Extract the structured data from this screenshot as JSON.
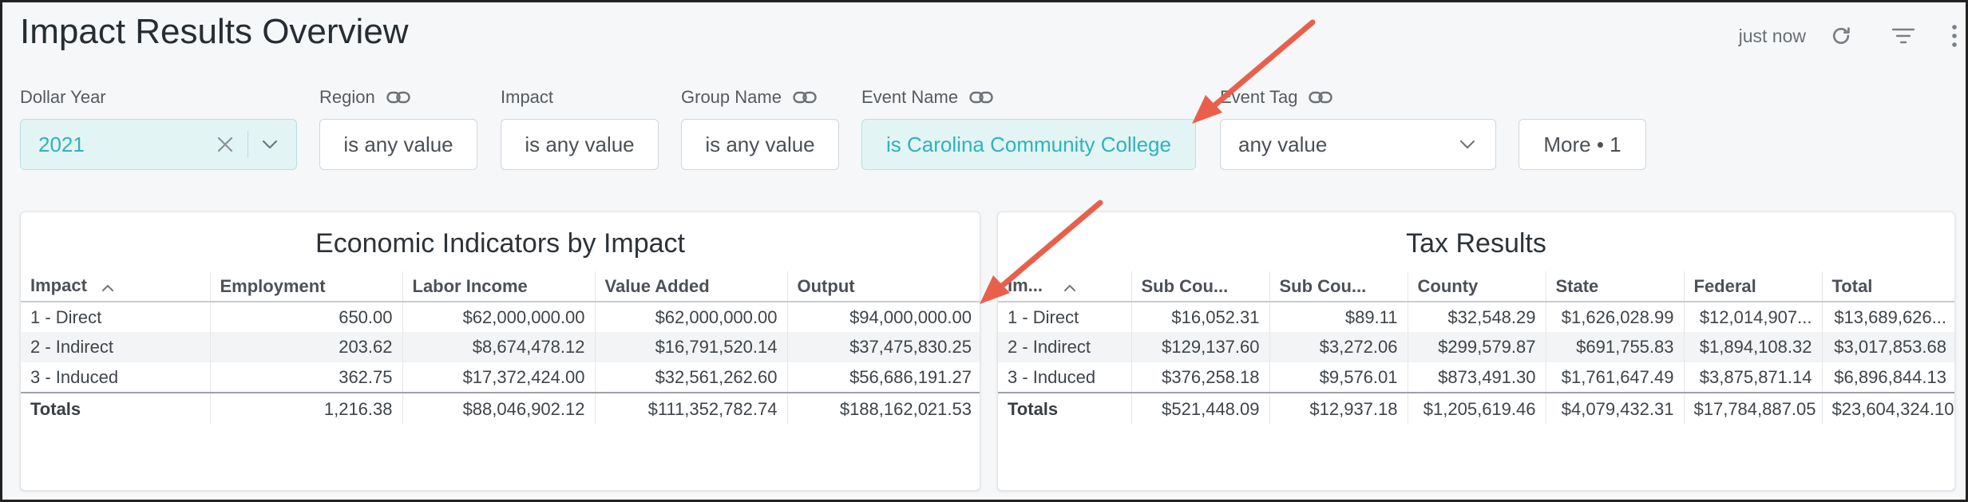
{
  "page": {
    "title": "Impact Results Overview",
    "updated": "just now"
  },
  "filters": [
    {
      "label": "Dollar Year",
      "value": "2021"
    },
    {
      "label": "Region",
      "value": "is any value"
    },
    {
      "label": "Impact",
      "value": "is any value"
    },
    {
      "label": "Group Name",
      "value": "is any value"
    },
    {
      "label": "Event Name",
      "value": "is Carolina Community College"
    },
    {
      "label": "Event Tag",
      "value": "any value"
    },
    {
      "label": "",
      "value": "More • 1"
    }
  ],
  "economic": {
    "title": "Economic Indicators by Impact",
    "headers": [
      "Impact",
      "Employment",
      "Labor Income",
      "Value Added",
      "Output"
    ],
    "rows": [
      [
        "1 - Direct",
        "650.00",
        "$62,000,000.00",
        "$62,000,000.00",
        "$94,000,000.00"
      ],
      [
        "2 - Indirect",
        "203.62",
        "$8,674,478.12",
        "$16,791,520.14",
        "$37,475,830.25"
      ],
      [
        "3 - Induced",
        "362.75",
        "$17,372,424.00",
        "$32,561,262.60",
        "$56,686,191.27"
      ]
    ],
    "totals": [
      "Totals",
      "1,216.38",
      "$88,046,902.12",
      "$111,352,782.74",
      "$188,162,021.53"
    ]
  },
  "tax": {
    "title": "Tax Results",
    "headers": [
      "Im...",
      "Sub Cou...",
      "Sub Cou...",
      "County",
      "State",
      "Federal",
      "Total"
    ],
    "rows": [
      [
        "1 - Direct",
        "$16,052.31",
        "$89.11",
        "$32,548.29",
        "$1,626,028.99",
        "$12,014,907...",
        "$13,689,626..."
      ],
      [
        "2 - Indirect",
        "$129,137.60",
        "$3,272.06",
        "$299,579.87",
        "$691,755.83",
        "$1,894,108.32",
        "$3,017,853.68"
      ],
      [
        "3 - Induced",
        "$376,258.18",
        "$9,576.01",
        "$873,491.30",
        "$1,761,647.49",
        "$3,875,871.14",
        "$6,896,844.13"
      ]
    ],
    "totals": [
      "Totals",
      "$521,448.09",
      "$12,937.18",
      "$1,205,619.46",
      "$4,079,432.31",
      "$17,784,887.05",
      "$23,604,324.10"
    ]
  },
  "colors": {
    "accent": "#2fb3ba",
    "annotation_arrow": "#e8604c"
  }
}
